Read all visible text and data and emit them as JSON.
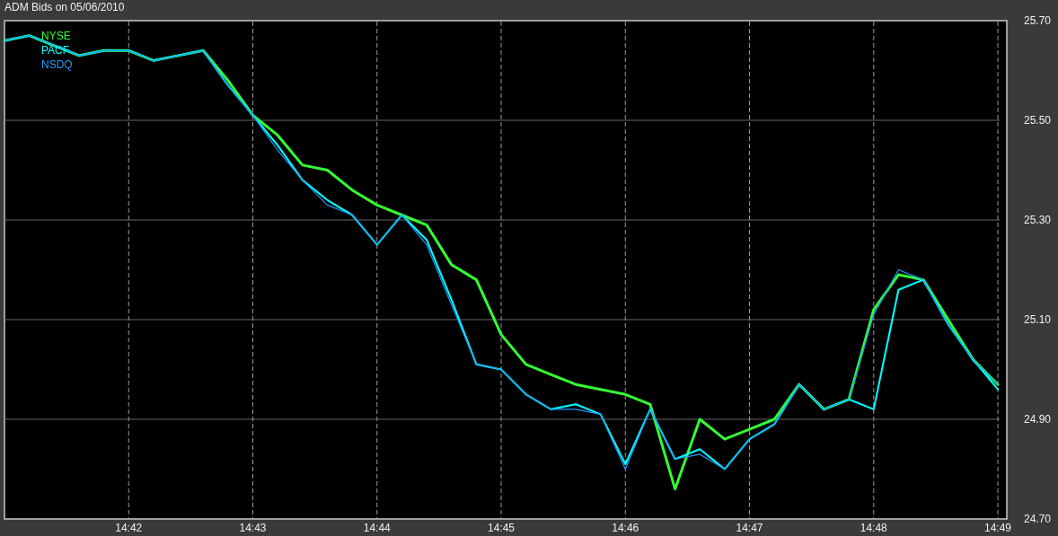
{
  "chart": {
    "chart_data": {
      "type": "line",
      "title": "ADM Bids on 05/06/2010",
      "categories": [
        null,
        null,
        null,
        null,
        null,
        "14:42",
        null,
        null,
        null,
        null,
        "14:43",
        null,
        null,
        null,
        null,
        "14:44",
        null,
        null,
        null,
        null,
        "14:45",
        null,
        null,
        null,
        null,
        "14:46",
        null,
        null,
        null,
        null,
        "14:47",
        null,
        null,
        null,
        null,
        "14:48",
        null,
        null,
        null,
        null,
        "14:49"
      ],
      "series": [
        {
          "name": "NYSE",
          "color": "#33ff33",
          "values": [
            25.66,
            25.67,
            25.65,
            25.63,
            25.64,
            25.64,
            25.62,
            25.63,
            25.64,
            25.58,
            25.51,
            25.47,
            25.41,
            25.4,
            25.36,
            25.33,
            25.31,
            25.29,
            25.21,
            25.18,
            25.07,
            25.01,
            24.99,
            24.97,
            24.96,
            24.95,
            24.93,
            24.76,
            24.9,
            24.86,
            24.88,
            24.9,
            24.97,
            24.92,
            24.94,
            25.12,
            25.19,
            25.18,
            25.1,
            25.02,
            24.97
          ]
        },
        {
          "name": "PACF",
          "color": "#00ffff",
          "values": [
            25.66,
            25.67,
            25.65,
            25.63,
            25.64,
            25.64,
            25.62,
            25.63,
            25.64,
            25.57,
            25.51,
            25.45,
            25.38,
            25.34,
            25.31,
            25.25,
            25.31,
            25.26,
            25.14,
            25.01,
            25.0,
            24.95,
            24.92,
            24.93,
            24.91,
            24.81,
            24.92,
            24.82,
            24.84,
            24.8,
            24.86,
            24.89,
            24.97,
            24.92,
            24.94,
            24.92,
            25.16,
            25.18,
            25.09,
            25.02,
            24.96
          ]
        },
        {
          "name": "NSDQ",
          "color": "#1e9bff",
          "values": [
            25.66,
            25.67,
            25.65,
            25.63,
            25.64,
            25.64,
            25.62,
            25.63,
            25.64,
            25.57,
            25.51,
            25.44,
            25.38,
            25.33,
            25.31,
            25.25,
            25.31,
            25.25,
            25.13,
            25.01,
            25.0,
            24.95,
            24.92,
            24.92,
            24.91,
            24.8,
            24.92,
            24.82,
            24.83,
            24.8,
            24.86,
            24.89,
            24.97,
            24.92,
            24.94,
            25.11,
            25.2,
            25.18,
            25.09,
            25.02,
            24.97
          ]
        }
      ],
      "grid": true,
      "ylim": [
        24.7,
        25.7
      ],
      "yticks": [
        {
          "value": 25.7,
          "label": "25.70"
        },
        {
          "value": 25.5,
          "label": "25.50"
        },
        {
          "value": 25.3,
          "label": "25.30"
        },
        {
          "value": 25.1,
          "label": "25.10"
        },
        {
          "value": 24.9,
          "label": "24.90"
        },
        {
          "value": 24.7,
          "label": "24.70"
        }
      ]
    }
  }
}
